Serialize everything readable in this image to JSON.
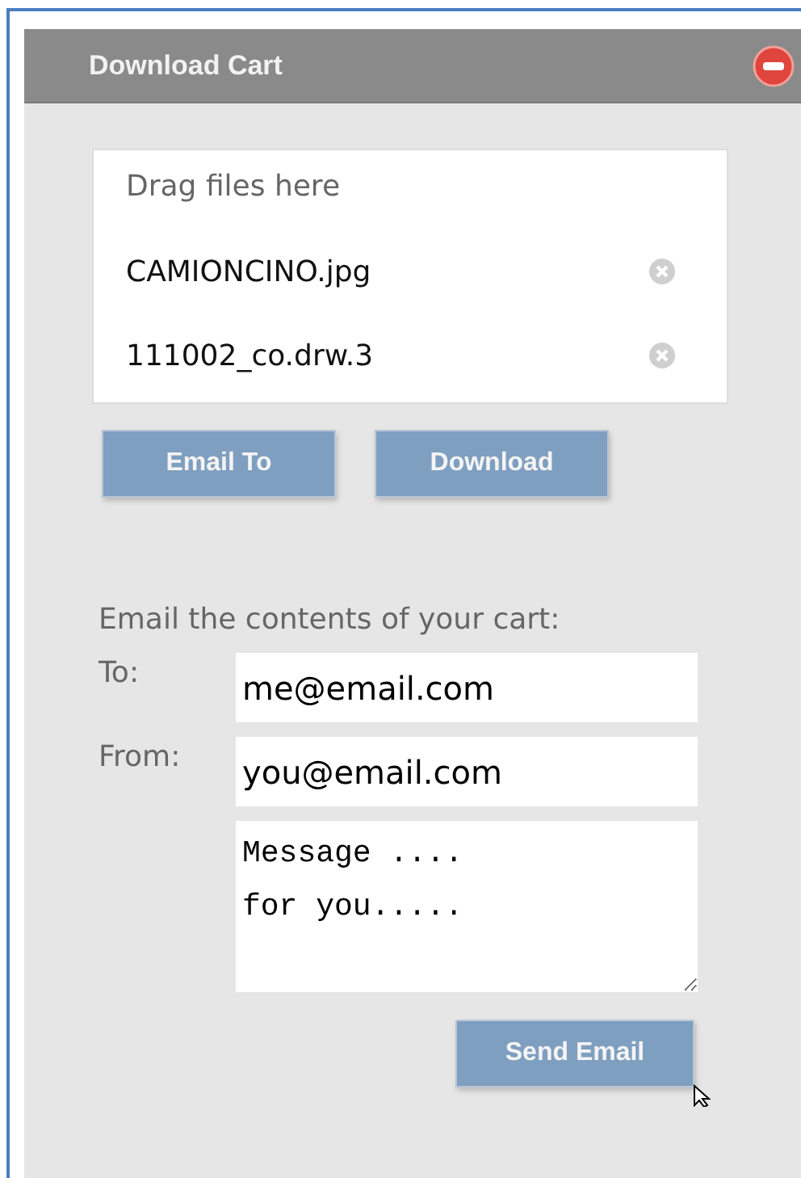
{
  "panel": {
    "title": "Download Cart"
  },
  "cart": {
    "hint": "Drag files here",
    "files": [
      {
        "name": "CAMIONCINO.jpg"
      },
      {
        "name": "111002_co.drw.3"
      }
    ]
  },
  "actions": [
    "Email To",
    "Download"
  ],
  "email_form": {
    "intro": "Email the contents of your cart:",
    "to_label": "To:",
    "to": "me@email.com",
    "from_label": "From:",
    "from": "you@email.com",
    "message": "Message ....\nfor you.....",
    "send": "Send Email"
  }
}
